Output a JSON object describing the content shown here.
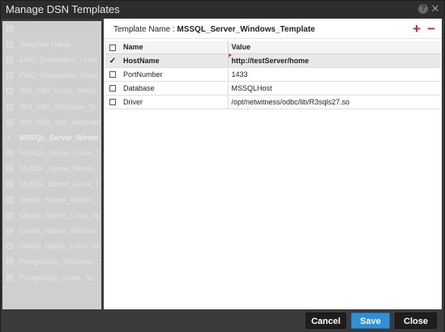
{
  "window": {
    "title": "Manage DSN Templates",
    "help_glyph": "?",
    "close_glyph": "✕"
  },
  "left_list": {
    "items": [
      {
        "label": "",
        "checked": false
      },
      {
        "label": "Template Name",
        "checked": false
      },
      {
        "label": "EMC_Greenplum_Linux...",
        "checked": false
      },
      {
        "label": "EMC_Greenplum_Wind...",
        "checked": false
      },
      {
        "label": "IBM_DB2_Linux_Templ...",
        "checked": false
      },
      {
        "label": "IBM_DB2_Windows_Te...",
        "checked": false
      },
      {
        "label": "IBM_DB2_Zos_Template",
        "checked": false
      },
      {
        "label": "MSSQL_Server_Windo...",
        "checked": true
      },
      {
        "label": "MSSQL_Server_Linux_T...",
        "checked": false
      },
      {
        "label": "MySQL_Server_Windo...",
        "checked": false
      },
      {
        "label": "MySQL_Server_Linux_T...",
        "checked": false
      },
      {
        "label": "Oracle_Server_Windo...",
        "checked": false
      },
      {
        "label": "Oracle_Server_Linux_Te...",
        "checked": false
      },
      {
        "label": "Oracle_Native_Window...",
        "checked": false
      },
      {
        "label": "Oracle_Native_Linux_Te...",
        "checked": false
      },
      {
        "label": "PostgreSQL_Windows...",
        "checked": false
      },
      {
        "label": "PostgreSQL_Linux_Te...",
        "checked": false
      }
    ]
  },
  "template": {
    "label": "Template Name : ",
    "name": "MSSQL_Server_Windows_Template",
    "add_glyph": "+",
    "remove_glyph": "−"
  },
  "table": {
    "headers": {
      "name": "Name",
      "value": "Value"
    },
    "rows": [
      {
        "name": "HostName",
        "value": "http://testServer/home",
        "checked": true,
        "selected": true
      },
      {
        "name": "PortNumber",
        "value": "1433",
        "checked": false,
        "selected": false
      },
      {
        "name": "Database",
        "value": "MSSQLHost",
        "checked": false,
        "selected": false
      },
      {
        "name": "Driver",
        "value": "/opt/netwitness/odbc/lib/R3sqls27.so",
        "checked": false,
        "selected": false
      }
    ]
  },
  "footer": {
    "cancel_label": "Cancel",
    "save_label": "Save",
    "close_label": "Close"
  },
  "colors": {
    "accent": "#2f91d9",
    "danger": "#e01c1c",
    "titlebar": "#2d2d2d"
  }
}
